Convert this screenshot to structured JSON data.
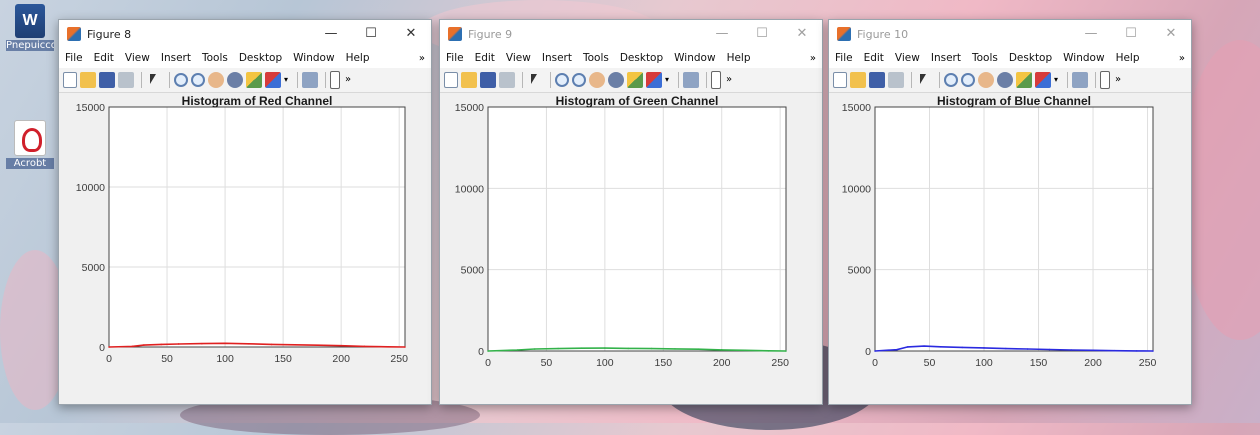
{
  "desktop": {
    "icons": [
      {
        "name": "word-document",
        "label": "Pnepuicco"
      },
      {
        "name": "acrobat-pdf",
        "label": "Acrobt"
      }
    ]
  },
  "menu_items": [
    "File",
    "Edit",
    "View",
    "Insert",
    "Tools",
    "Desktop",
    "Window",
    "Help"
  ],
  "window_controls": {
    "minimize": "—",
    "maximize": "☐",
    "close": "✕"
  },
  "windows": [
    {
      "id": "figure-8-red",
      "title": "Figure 8",
      "active": true,
      "color": "#e02020",
      "chart_data": {
        "type": "line",
        "title": "Histogram of Red Channel",
        "xlabel": "",
        "ylabel": "",
        "xlim": [
          0,
          255
        ],
        "ylim": [
          0,
          15000
        ],
        "xticks": [
          "0",
          "50",
          "100",
          "150",
          "200",
          "250"
        ],
        "yticks": [
          "0",
          "5000",
          "10000",
          "15000"
        ],
        "grid": true,
        "series": [
          {
            "x": [
              0,
              20,
              30,
              45,
              60,
              80,
              100,
              120,
              140,
              160,
              180,
              200,
              220,
              240,
              255
            ],
            "values": [
              0,
              40,
              120,
              160,
              190,
              210,
              230,
              200,
              160,
              140,
              110,
              80,
              40,
              15,
              0
            ]
          }
        ]
      }
    },
    {
      "id": "figure-9-green",
      "title": "Figure 9",
      "active": false,
      "color": "#33b24a",
      "chart_data": {
        "type": "line",
        "title": "Histogram of Green Channel",
        "xlabel": "",
        "ylabel": "",
        "xlim": [
          0,
          255
        ],
        "ylim": [
          0,
          15000
        ],
        "xticks": [
          "0",
          "50",
          "100",
          "150",
          "200",
          "250"
        ],
        "yticks": [
          "0",
          "5000",
          "10000",
          "15000"
        ],
        "grid": true,
        "series": [
          {
            "x": [
              0,
              25,
              40,
              60,
              80,
              100,
              120,
              140,
              160,
              180,
              200,
              220,
              240,
              255
            ],
            "values": [
              0,
              60,
              120,
              150,
              170,
              180,
              160,
              150,
              130,
              110,
              70,
              40,
              10,
              0
            ]
          }
        ]
      }
    },
    {
      "id": "figure-10-blue",
      "title": "Figure 10",
      "active": false,
      "color": "#2a2ae0",
      "chart_data": {
        "type": "line",
        "title": "Histogram of Blue Channel",
        "xlabel": "",
        "ylabel": "",
        "xlim": [
          0,
          255
        ],
        "ylim": [
          0,
          15000
        ],
        "xticks": [
          "0",
          "50",
          "100",
          "150",
          "200",
          "250"
        ],
        "yticks": [
          "0",
          "5000",
          "10000",
          "15000"
        ],
        "grid": true,
        "series": [
          {
            "x": [
              0,
              20,
              30,
              45,
              60,
              80,
              100,
              120,
              140,
              160,
              180,
              200,
              220,
              240,
              255
            ],
            "values": [
              0,
              80,
              250,
              300,
              260,
              220,
              190,
              150,
              120,
              90,
              60,
              40,
              20,
              8,
              0
            ]
          }
        ]
      }
    }
  ]
}
